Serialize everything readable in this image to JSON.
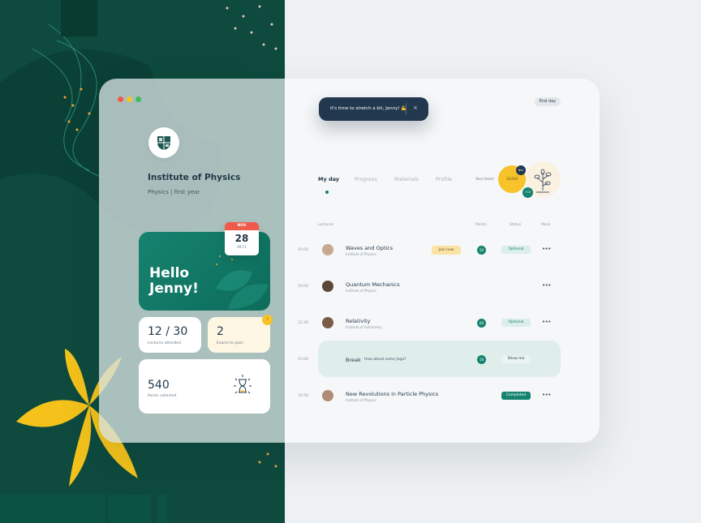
{
  "colors": {
    "green": "#16836f",
    "dark_green": "#0e4a3e",
    "navy": "#22384f",
    "yellow": "#f7c22a",
    "red": "#ef5a4b"
  },
  "window": {
    "dots": [
      "#f15a4a",
      "#f7c22a",
      "#3cbf5b"
    ]
  },
  "institute": {
    "name": "Institute of Physics",
    "subtitle": "Physics | first year",
    "logo_icon": "shield-crest-icon"
  },
  "greeting": {
    "text": "Hello Jenny!"
  },
  "date": {
    "month": "NOV",
    "day": "28",
    "time": "09:11"
  },
  "stats": {
    "lectures": {
      "value": "12 / 30",
      "label": "Lectures attended"
    },
    "exams": {
      "value": "2",
      "label": "Exams to pass",
      "badge": "!"
    },
    "points": {
      "value": "540",
      "label": "Points collected",
      "icon": "hourglass-icon"
    }
  },
  "toast": {
    "text": "It's time to stretch a bit, Jenny! 💪",
    "close": "×"
  },
  "header": {
    "end_day": "End day"
  },
  "tabs": [
    {
      "label": "My day",
      "active": true
    },
    {
      "label": "Progress"
    },
    {
      "label": "Materials"
    },
    {
      "label": "Profile"
    }
  ],
  "team": {
    "label": "Your team",
    "yellow": "10,010",
    "dark": "8m",
    "green": "+10",
    "plant_icon": "plant-icon"
  },
  "columns": {
    "lectures": "Lectures",
    "points": "Points",
    "status": "Status",
    "more": "More"
  },
  "lectures": [
    {
      "time": "10:00",
      "title": "Waves and Optics",
      "sub": "Institute of Physics",
      "action": "Join now",
      "points": "50",
      "status": "Optional",
      "more": "•••"
    },
    {
      "time": "10:00",
      "title": "Quantum Mechanics",
      "sub": "Institute of Physics",
      "more": "•••"
    },
    {
      "time": "12:30",
      "title": "Relativity",
      "sub": "Institute of Astronomy",
      "points": "60",
      "status": "Optional",
      "more": "•••"
    },
    {
      "time": "15:00",
      "title": "Break",
      "sub": "How about some Joga?",
      "points": "10",
      "status": "Show me"
    },
    {
      "time": "16:30",
      "title": "New Revolutions in Particle Physics",
      "sub": "Institute of Physics",
      "status": "Completed",
      "more": "•••"
    }
  ]
}
